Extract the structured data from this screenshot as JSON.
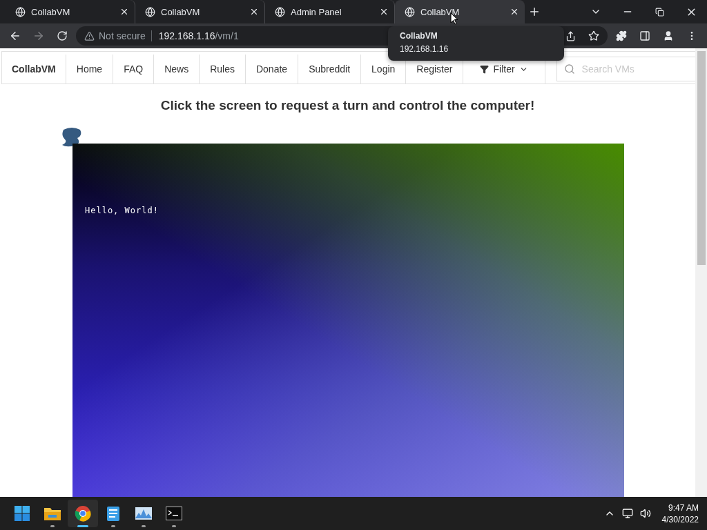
{
  "browser": {
    "tabs": [
      {
        "title": "CollabVM",
        "selected": false
      },
      {
        "title": "CollabVM",
        "selected": false
      },
      {
        "title": "Admin Panel",
        "selected": false
      },
      {
        "title": "CollabVM",
        "selected": true
      }
    ],
    "address": {
      "security": "Not secure",
      "host": "192.168.1.16",
      "path": "/vm/1"
    },
    "tooltip": {
      "title": "CollabVM",
      "url": "192.168.1.16"
    }
  },
  "page": {
    "brand": "CollabVM",
    "nav": [
      "Home",
      "FAQ",
      "News",
      "Rules",
      "Donate",
      "Subreddit",
      "Login",
      "Register"
    ],
    "filter": "Filter",
    "search": {
      "placeholder": "Search VMs"
    },
    "heading": "Click the screen to request a turn and control the computer!",
    "vm_screen": {
      "text": "Hello, World!"
    }
  },
  "taskbar": {
    "apps": [
      {
        "kind": "start",
        "selected": false,
        "running": false
      },
      {
        "kind": "folder",
        "selected": false,
        "running": true
      },
      {
        "kind": "chrome",
        "selected": true,
        "running": true
      },
      {
        "kind": "notepad",
        "selected": false,
        "running": true
      },
      {
        "kind": "monitor",
        "selected": false,
        "running": true
      },
      {
        "kind": "terminal",
        "selected": false,
        "running": true
      }
    ],
    "time": "9:47 AM",
    "date": "4/30/2022"
  }
}
